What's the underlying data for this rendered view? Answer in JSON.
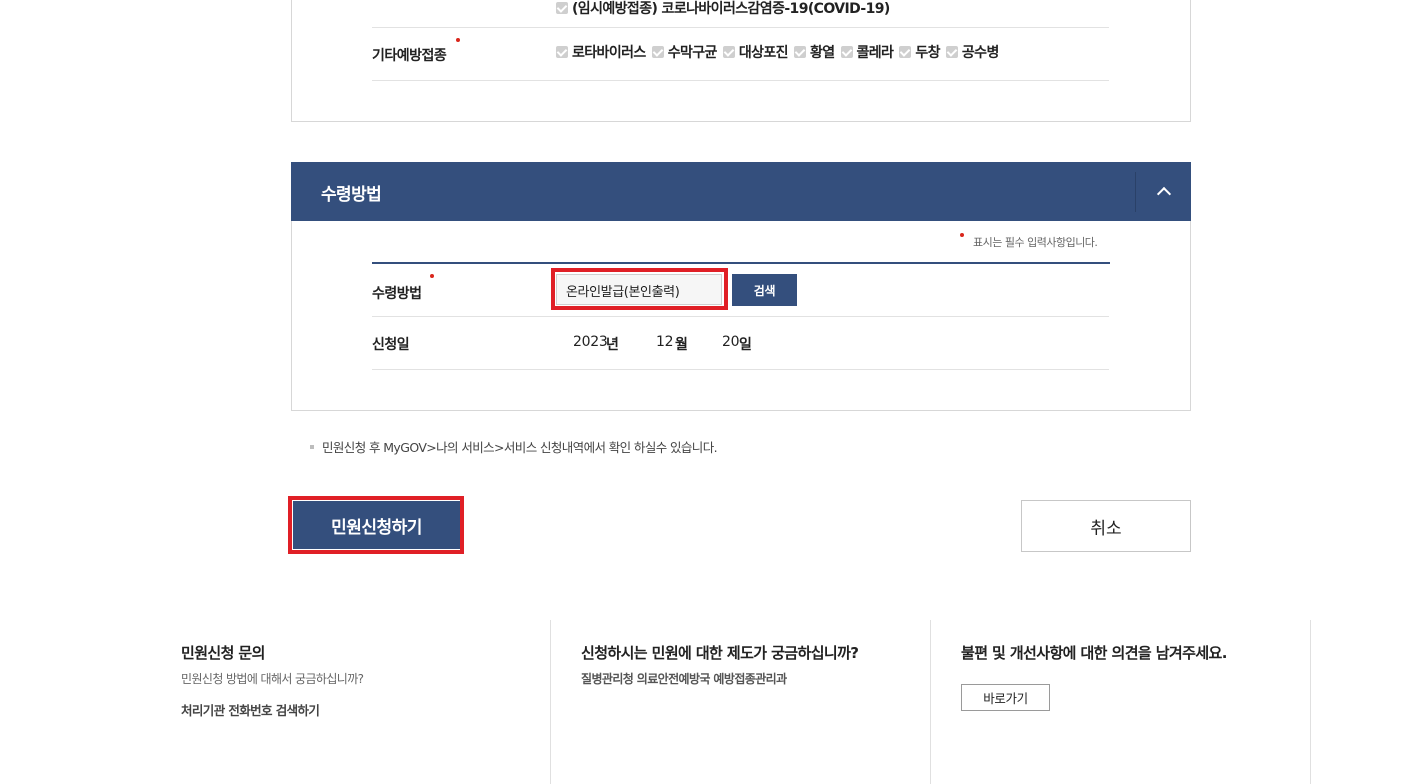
{
  "vaccination": {
    "covid_item": "(임시예방접종) 코로나바이러스감염증-19(COVID-19)",
    "other_label": "기타예방접종",
    "other_items": [
      "로타바이러스",
      "수막구균",
      "대상포진",
      "황열",
      "콜레라",
      "두창",
      "공수병"
    ]
  },
  "receipt": {
    "section_title": "수령방법",
    "required_note": "표시는 필수 입력사항입니다.",
    "method_label": "수령방법",
    "method_value": "온라인발급(본인출력)",
    "search_button": "검색",
    "date_label": "신청일",
    "date": {
      "year": "2023",
      "year_unit": "년",
      "month": "12",
      "month_unit": "월",
      "day": "20",
      "day_unit": "일"
    }
  },
  "info_note": "민원신청 후 MyGOV>나의 서비스>서비스 신청내역에서 확인 하실수 있습니다.",
  "actions": {
    "submit": "민원신청하기",
    "cancel": "취소"
  },
  "footer": {
    "col1": {
      "title": "민원신청 문의",
      "sub": "민원신청 방법에 대해서 궁금하십니까?",
      "link": "처리기관 전화번호 검색하기"
    },
    "col2": {
      "title": "신청하시는 민원에 대한 제도가 궁금하십니까?",
      "sub": "질병관리청 의료안전예방국 예방접종관리과"
    },
    "col3": {
      "title": "불편 및 개선사항에 대한 의견을 남겨주세요.",
      "button": "바로가기"
    }
  },
  "colors": {
    "navy": "#344f7d",
    "highlight": "#e01f26",
    "required_dot": "#d9261c"
  }
}
